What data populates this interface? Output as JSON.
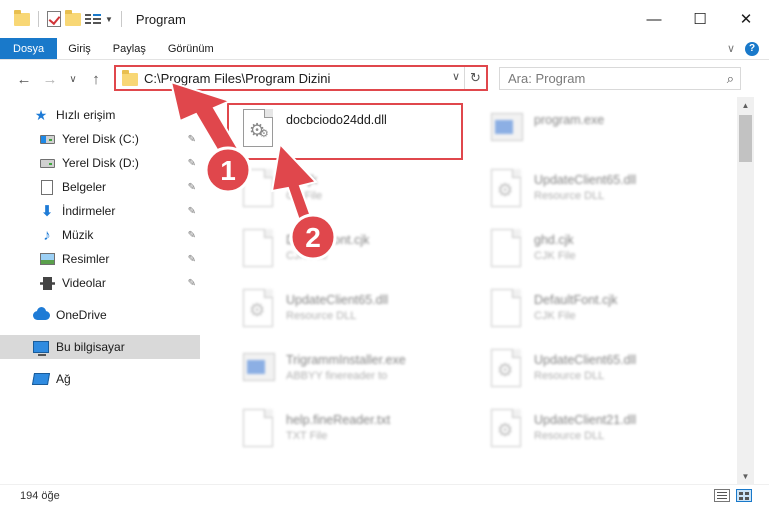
{
  "window": {
    "title": "Program",
    "minimize": "—",
    "maximize": "☐",
    "close": "✕"
  },
  "ribbon": {
    "tabs": [
      "Dosya",
      "Giriş",
      "Paylaş",
      "Görünüm"
    ],
    "expand": "∨",
    "help": "?"
  },
  "nav": {
    "back": "←",
    "forward": "→",
    "recent": "∨",
    "up": "↑"
  },
  "address": {
    "path": "C:\\Program Files\\Program Dizini",
    "dropdown": "∨",
    "refresh": "↻"
  },
  "search": {
    "placeholder": "Ara: Program",
    "icon": "⌕"
  },
  "sidebar": {
    "items": [
      {
        "label": "Hızlı erişim",
        "icon": "star-icon",
        "pinned": false
      },
      {
        "label": "Yerel Disk (C:)",
        "icon": "drive-icon",
        "pinned": true
      },
      {
        "label": "Yerel Disk (D:)",
        "icon": "drive-icon",
        "pinned": true
      },
      {
        "label": "Belgeler",
        "icon": "documents-icon",
        "pinned": true
      },
      {
        "label": "İndirmeler",
        "icon": "download-icon",
        "pinned": true
      },
      {
        "label": "Müzik",
        "icon": "music-icon",
        "pinned": true
      },
      {
        "label": "Resimler",
        "icon": "pictures-icon",
        "pinned": true
      },
      {
        "label": "Videolar",
        "icon": "videos-icon",
        "pinned": true
      },
      {
        "label": "OneDrive",
        "icon": "cloud-icon",
        "pinned": false
      },
      {
        "label": "Bu bilgisayar",
        "icon": "computer-icon",
        "pinned": false
      },
      {
        "label": "Ağ",
        "icon": "network-icon",
        "pinned": false
      }
    ],
    "pin_glyph": "📌"
  },
  "files": [
    {
      "name": "docbciodo24dd.dll",
      "type": "",
      "icon": "dll-icon"
    },
    {
      "name": "program.exe",
      "type": "",
      "icon": "exe-icon"
    },
    {
      "name": "ck.cjk",
      "type": "CK File",
      "icon": "file-icon"
    },
    {
      "name": "UpdateClient65.dll",
      "type": "Resource DLL",
      "icon": "dll-icon"
    },
    {
      "name": "DefaultFont.cjk",
      "type": "CJK File",
      "icon": "file-icon"
    },
    {
      "name": "ghd.cjk",
      "type": "CJK File",
      "icon": "file-icon"
    },
    {
      "name": "UpdateClient65.dll",
      "type": "Resource DLL",
      "icon": "dll-icon"
    },
    {
      "name": "DefaultFont.cjk",
      "type": "CJK File",
      "icon": "file-icon"
    },
    {
      "name": "TrigrammInstaller.exe",
      "type": "ABBYY finereader to",
      "icon": "exe-icon"
    },
    {
      "name": "UpdateClient65.dll",
      "type": "Resource DLL",
      "icon": "dll-icon"
    },
    {
      "name": "help.fineReader.txt",
      "type": "TXT File",
      "icon": "file-icon"
    },
    {
      "name": "UpdateClient21.dll",
      "type": "Resource DLL",
      "icon": "dll-icon"
    }
  ],
  "annotations": {
    "step1": "1",
    "step2": "2",
    "color": "#e0474c"
  },
  "status": {
    "item_count": "194 öğe"
  },
  "colors": {
    "accent": "#1979ca",
    "highlight": "#e0474c"
  }
}
